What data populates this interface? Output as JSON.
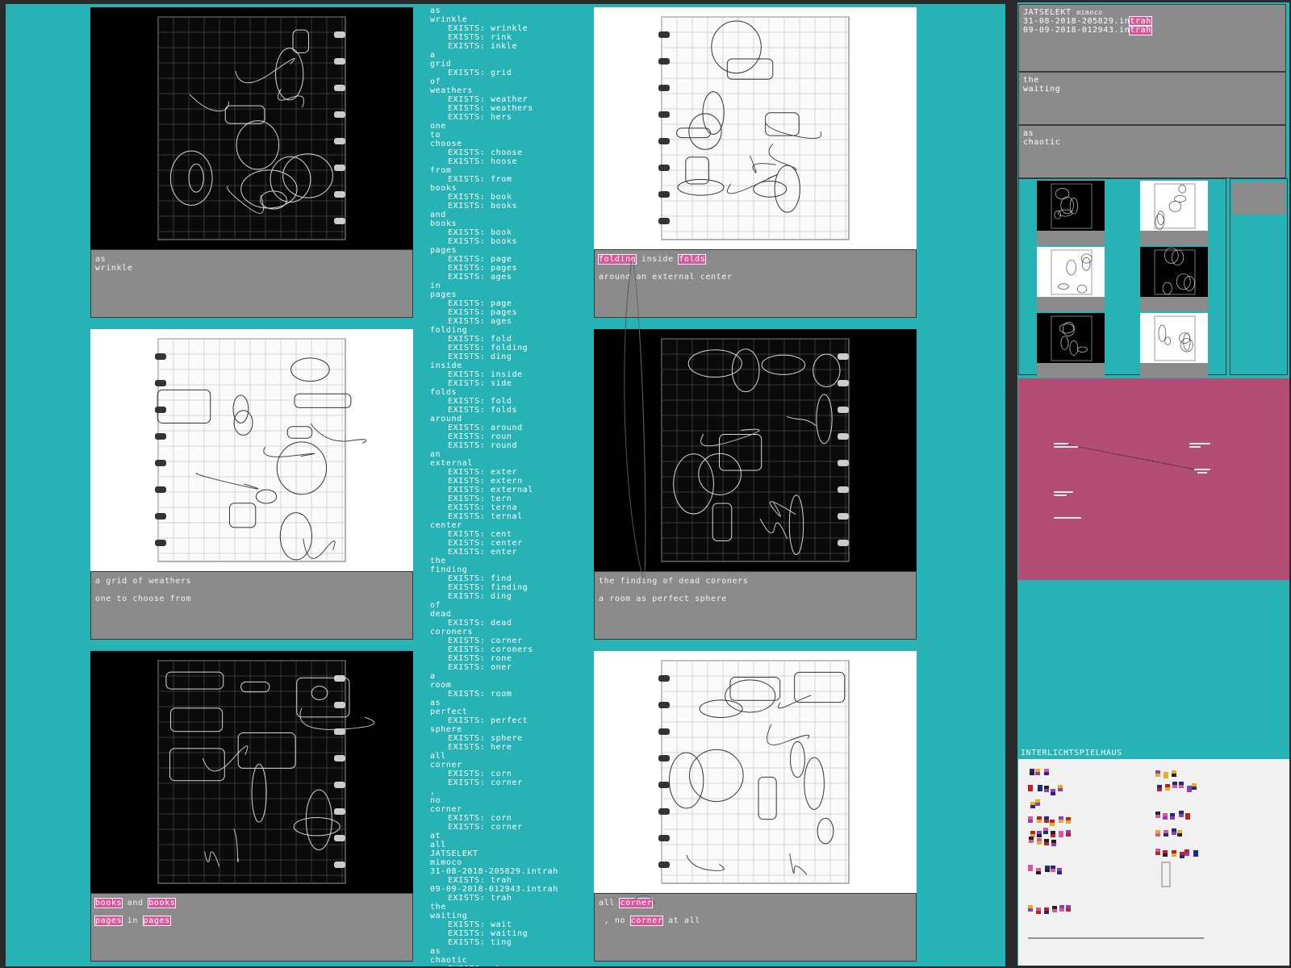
{
  "cards": [
    {
      "id": "c1",
      "theme": "dark",
      "cap": [
        [
          "as"
        ],
        [
          "wrinkle"
        ]
      ]
    },
    {
      "id": "c2",
      "theme": "light",
      "cap": [
        [
          "folding",
          "hl"
        ],
        [
          " inside ",
          ""
        ],
        [
          "folds",
          "hl"
        ],
        [
          null
        ],
        [
          "around an external center"
        ]
      ]
    },
    {
      "id": "c3",
      "theme": "light",
      "cap": [
        [
          "a grid of weathers"
        ],
        [
          null
        ],
        [
          "one to choose from"
        ]
      ]
    },
    {
      "id": "c4",
      "theme": "dark",
      "cap": [
        [
          "the finding of dead coroners"
        ],
        [
          null
        ],
        [
          "a room as perfect sphere"
        ]
      ]
    },
    {
      "id": "c5",
      "theme": "dark",
      "cap": [
        [
          "books",
          "hl"
        ],
        [
          " and ",
          ""
        ],
        [
          "books",
          "hl"
        ],
        [
          null
        ],
        [
          "pages",
          "hl"
        ],
        [
          " in ",
          ""
        ],
        [
          "pages",
          "hl"
        ]
      ]
    },
    {
      "id": "c6",
      "theme": "light",
      "cap": [
        [
          "all ",
          ""
        ],
        [
          "corner",
          "hl"
        ],
        [
          null
        ],
        [
          " , no ",
          ""
        ],
        [
          "corner",
          "hl"
        ],
        [
          " at all",
          ""
        ]
      ]
    }
  ],
  "wordlist": [
    [
      "as",
      0
    ],
    [
      "wrinkle",
      0
    ],
    [
      "EXISTS: wrinkle",
      1
    ],
    [
      "EXISTS: rink",
      1
    ],
    [
      "EXISTS: inkle",
      1
    ],
    [
      "a",
      0
    ],
    [
      "grid",
      0
    ],
    [
      "EXISTS: grid",
      1
    ],
    [
      "of",
      0
    ],
    [
      "weathers",
      0
    ],
    [
      "EXISTS: weather",
      1
    ],
    [
      "EXISTS: weathers",
      1
    ],
    [
      "EXISTS: hers",
      1
    ],
    [
      "one",
      0
    ],
    [
      "to",
      0
    ],
    [
      "choose",
      0
    ],
    [
      "EXISTS: choose",
      1
    ],
    [
      "EXISTS: hoose",
      1
    ],
    [
      "from",
      0
    ],
    [
      "EXISTS: from",
      1
    ],
    [
      "books",
      0
    ],
    [
      "EXISTS: book",
      1
    ],
    [
      "EXISTS: books",
      1
    ],
    [
      "and",
      0
    ],
    [
      "books",
      0
    ],
    [
      "EXISTS: book",
      1
    ],
    [
      "EXISTS: books",
      1
    ],
    [
      "pages",
      0
    ],
    [
      "EXISTS: page",
      1
    ],
    [
      "EXISTS: pages",
      1
    ],
    [
      "EXISTS: ages",
      1
    ],
    [
      "in",
      0
    ],
    [
      "pages",
      0
    ],
    [
      "EXISTS: page",
      1
    ],
    [
      "EXISTS: pages",
      1
    ],
    [
      "EXISTS: ages",
      1
    ],
    [
      "folding",
      0
    ],
    [
      "EXISTS: fold",
      1
    ],
    [
      "EXISTS: folding",
      1
    ],
    [
      "EXISTS: ding",
      1
    ],
    [
      "inside",
      0
    ],
    [
      "EXISTS: inside",
      1
    ],
    [
      "EXISTS: side",
      1
    ],
    [
      "folds",
      0
    ],
    [
      "EXISTS: fold",
      1
    ],
    [
      "EXISTS: folds",
      1
    ],
    [
      "around",
      0
    ],
    [
      "EXISTS: around",
      1
    ],
    [
      "EXISTS: roun",
      1
    ],
    [
      "EXISTS: round",
      1
    ],
    [
      "an",
      0
    ],
    [
      "external",
      0
    ],
    [
      "EXISTS: exter",
      1
    ],
    [
      "EXISTS: extern",
      1
    ],
    [
      "EXISTS: external",
      1
    ],
    [
      "EXISTS: tern",
      1
    ],
    [
      "EXISTS: terna",
      1
    ],
    [
      "EXISTS: ternal",
      1
    ],
    [
      "center",
      0
    ],
    [
      "EXISTS: cent",
      1
    ],
    [
      "EXISTS: center",
      1
    ],
    [
      "EXISTS: enter",
      1
    ],
    [
      "the",
      0
    ],
    [
      "finding",
      0
    ],
    [
      "EXISTS: find",
      1
    ],
    [
      "EXISTS: finding",
      1
    ],
    [
      "EXISTS: ding",
      1
    ],
    [
      "of",
      0
    ],
    [
      "dead",
      0
    ],
    [
      "EXISTS: dead",
      1
    ],
    [
      "coroners",
      0
    ],
    [
      "EXISTS: corner",
      1
    ],
    [
      "EXISTS: coroners",
      1
    ],
    [
      "EXISTS: rone",
      1
    ],
    [
      "EXISTS: oner",
      1
    ],
    [
      "a",
      0
    ],
    [
      "room",
      0
    ],
    [
      "EXISTS: room",
      1
    ],
    [
      "as",
      0
    ],
    [
      "perfect",
      0
    ],
    [
      "EXISTS: perfect",
      1
    ],
    [
      "sphere",
      0
    ],
    [
      "EXISTS: sphere",
      1
    ],
    [
      "EXISTS: here",
      1
    ],
    [
      "all",
      0
    ],
    [
      "corner",
      0
    ],
    [
      "EXISTS: corn",
      1
    ],
    [
      "EXISTS: corner",
      1
    ],
    [
      ",",
      0
    ],
    [
      "no",
      0
    ],
    [
      "corner",
      0
    ],
    [
      "EXISTS: corn",
      1
    ],
    [
      "EXISTS: corner",
      1
    ],
    [
      "at",
      0
    ],
    [
      "all",
      0
    ],
    [
      "JATSELEKT",
      0
    ],
    [
      "mimoco",
      0
    ],
    [
      "31-08-2018-205829.intrah",
      0
    ],
    [
      "EXISTS: trah",
      1
    ],
    [
      "09-09-2018-012943.intrah",
      0
    ],
    [
      "EXISTS: trah",
      1
    ],
    [
      "the",
      0
    ],
    [
      "waiting",
      0
    ],
    [
      "EXISTS: wait",
      1
    ],
    [
      "EXISTS: waiting",
      1
    ],
    [
      "EXISTS: ting",
      1
    ],
    [
      "as",
      0
    ],
    [
      "chaotic",
      0
    ],
    [
      "EXISTS: chao",
      1
    ]
  ],
  "right": {
    "title": "JATSELEKT",
    "title_small": "mimoco",
    "file1_pre": "31-08-2018-205829.in",
    "file1_hl": "trah",
    "file2_pre": "09-09-2018-012943.in",
    "file2_hl": "trah",
    "box2": "the\nwaiting",
    "box3": "as\nchaotic",
    "house_label": "INTERLICHTSPIELHAUS"
  },
  "colors": {
    "accent": "#27b3b5",
    "highlight": "#d9589a",
    "caption_bg": "#8b8b8b",
    "pink_panel": "#b34d73"
  }
}
